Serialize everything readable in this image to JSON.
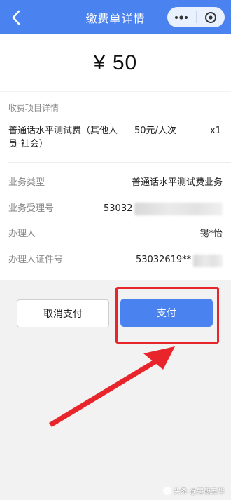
{
  "header": {
    "title": "缴费单详情",
    "back_icon": "chevron-left-icon",
    "menu_icon": "more-dots-icon",
    "close_icon": "target-circle-icon",
    "bg_color": "#4a82f0"
  },
  "amount": {
    "text": "¥ 50"
  },
  "details": {
    "section_title": "收费项目详情",
    "item": {
      "name": "普通话水平测试费（其他人员-社会）",
      "price": "50元/人次",
      "qty": "x1"
    },
    "rows": [
      {
        "label": "业务类型",
        "value": "普通话水平测试费业务"
      },
      {
        "label": "业务受理号",
        "value": "53032"
      },
      {
        "label": "办理人",
        "value": "锡*怡"
      },
      {
        "label": "办理人证件号",
        "value": "53032619**"
      }
    ]
  },
  "actions": {
    "cancel_label": "取消支付",
    "pay_label": "支付"
  },
  "annotation": {
    "highlight_color": "#e8252b"
  },
  "watermark": {
    "text": "头条 @旁観五华"
  }
}
